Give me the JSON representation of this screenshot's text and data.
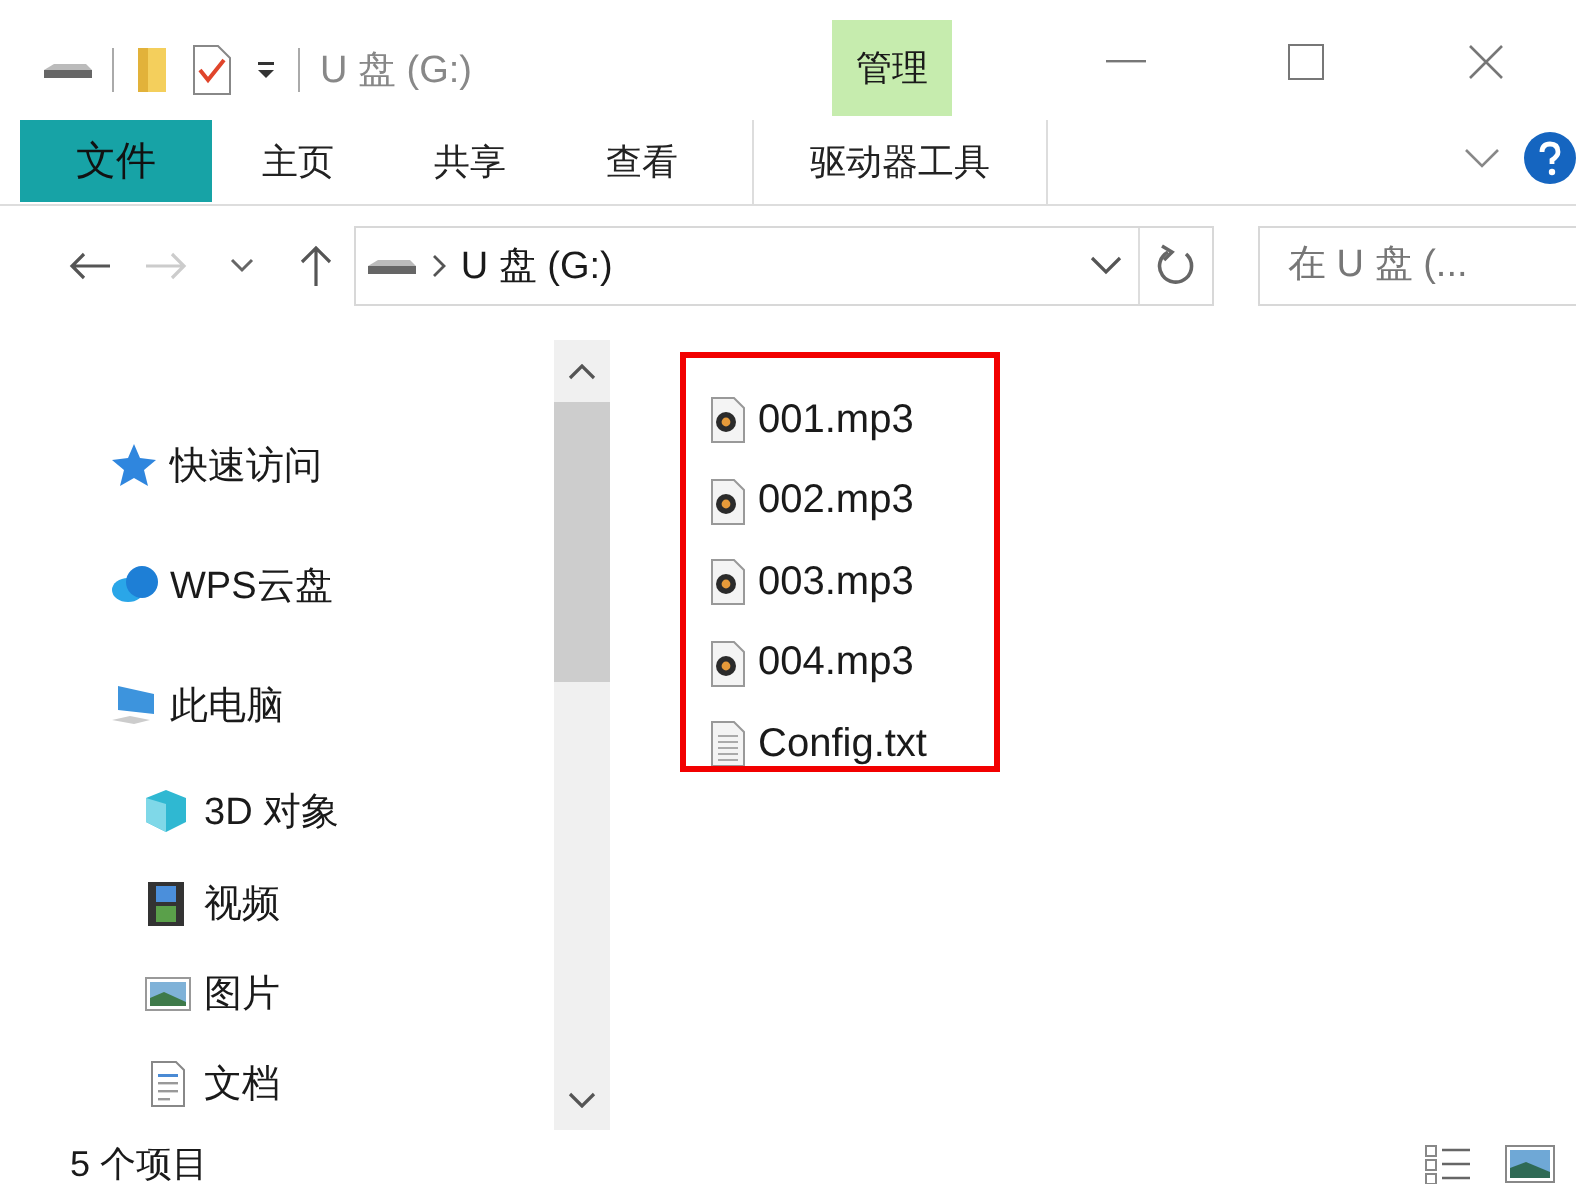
{
  "window": {
    "title": "U 盘 (G:)",
    "context_tab": "管理"
  },
  "ribbon_tabs": [
    {
      "label": "文件",
      "kind": "file"
    },
    {
      "label": "主页",
      "kind": "tab"
    },
    {
      "label": "共享",
      "kind": "tab"
    },
    {
      "label": "查看",
      "kind": "tab"
    },
    {
      "label": "驱动器工具",
      "kind": "context"
    }
  ],
  "address_bar": {
    "path": "U 盘 (G:)"
  },
  "search": {
    "placeholder": "在 U 盘 (..."
  },
  "sidebar": {
    "items": [
      {
        "label": "快速访问"
      },
      {
        "label": "WPS云盘"
      },
      {
        "label": "此电脑",
        "children": [
          {
            "label": "3D 对象"
          },
          {
            "label": "视频"
          },
          {
            "label": "图片"
          },
          {
            "label": "文档"
          }
        ]
      }
    ]
  },
  "files": [
    {
      "name": "001.mp3",
      "kind": "audio"
    },
    {
      "name": "002.mp3",
      "kind": "audio"
    },
    {
      "name": "003.mp3",
      "kind": "audio"
    },
    {
      "name": "004.mp3",
      "kind": "audio"
    },
    {
      "name": "Config.txt",
      "kind": "text"
    }
  ],
  "highlight": true,
  "status_bar": {
    "count": "5 个项目"
  }
}
